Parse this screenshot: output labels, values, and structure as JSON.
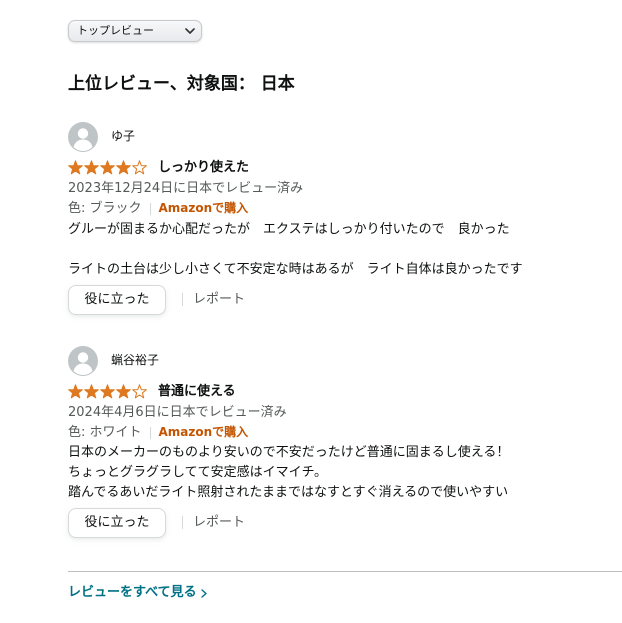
{
  "sort": {
    "selected": "トップレビュー"
  },
  "section_title": "上位レビュー、対象国： 日本",
  "reviews": [
    {
      "reviewer": "ゆ子",
      "rating": 4,
      "rating_max": 5,
      "title": "しっかり使えた",
      "date": "2023年12月24日に日本でレビュー済み",
      "variant": "色: ブラック",
      "verified": "Amazonで購入",
      "body": "グルーが固まるか心配だったが　エクステはしっかり付いたので　良かった\n\nライトの土台は少し小さくて不安定な時はあるが　ライト自体は良かったです",
      "helpful_label": "役に立った",
      "report_label": "レポート"
    },
    {
      "reviewer": "蝋谷裕子",
      "rating": 4,
      "rating_max": 5,
      "title": "普通に使える",
      "date": "2024年4月6日に日本でレビュー済み",
      "variant": "色: ホワイト",
      "verified": "Amazonで購入",
      "body": "日本のメーカーのものより安いので不安だったけど普通に固まるし使える！\nちょっとグラグラしてて安定感はイマイチ。\n踏んでるあいだライト照射されたままではなすとすぐ消えるので使いやすい",
      "helpful_label": "役に立った",
      "report_label": "レポート"
    }
  ],
  "see_all_label": "レビューをすべて見る",
  "colors": {
    "star": "#de7921",
    "verified": "#c45500",
    "link": "#007185",
    "muted": "#565959",
    "avatar": "#bfc4c6"
  },
  "icons": {
    "dropdown": "chevron-down-icon",
    "avatar": "user-avatar-icon",
    "star": "star-icon",
    "see_all": "chevron-right-icon"
  }
}
